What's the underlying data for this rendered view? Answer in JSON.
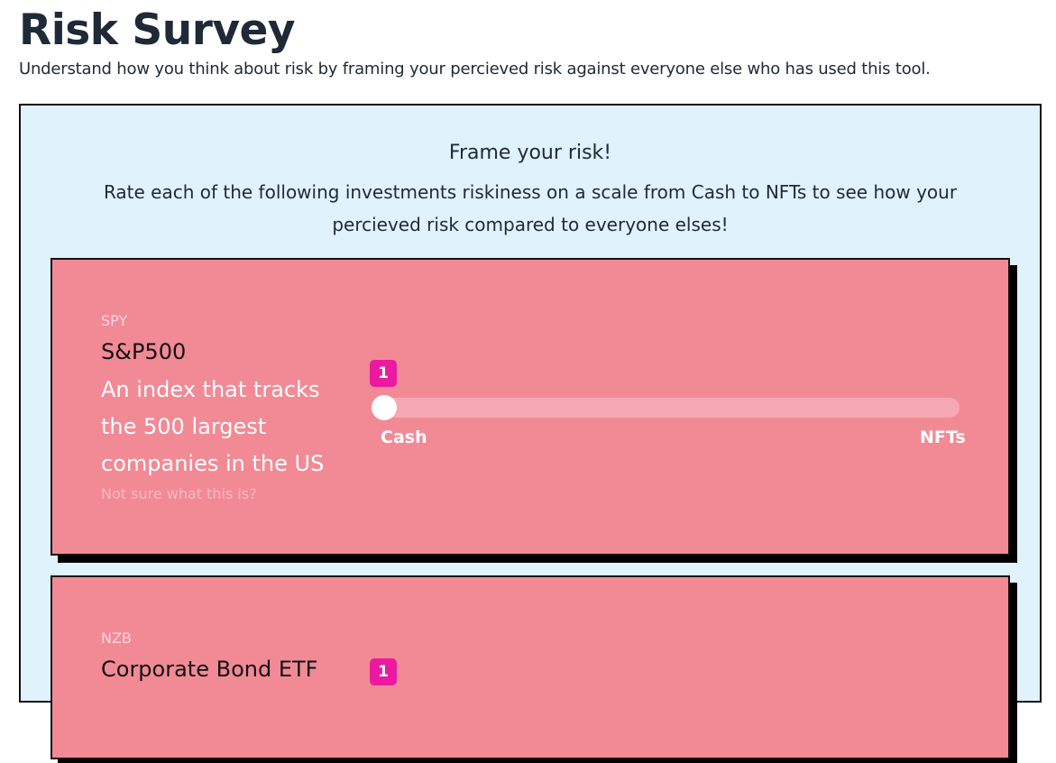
{
  "header": {
    "title": "Risk Survey",
    "subtitle": "Understand how you think about risk by framing your percieved risk against everyone else who has used this tool."
  },
  "panel": {
    "heading": "Frame your risk!",
    "description": "Rate each of the following investments riskiness on a scale from Cash to NFTs to see how your percieved risk compared to everyone elses!"
  },
  "cards": [
    {
      "code": "SPY",
      "name": "S&P500",
      "description": "An index that tracks the 500 largest companies in the US",
      "help": "Not sure what this is?",
      "slider": {
        "value": "1",
        "fraction": 0,
        "min_label": "Cash",
        "max_label": "NFTs"
      }
    },
    {
      "code": "NZB",
      "name": "Corporate Bond ETF",
      "slider": {
        "value": "1",
        "fraction": 0
      }
    }
  ],
  "colors": {
    "panel_bg": "#e0f2fc",
    "card_bg": "#f28a96",
    "slider_track": "#f6a8b2",
    "value_badge": "#ec1aa0"
  }
}
